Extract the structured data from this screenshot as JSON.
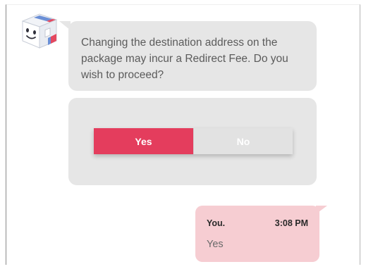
{
  "bot": {
    "avatar_icon": "package-box-mascot-icon",
    "message": "Changing the destination address on the package may incur a Redirect Fee. Do you wish to proceed?"
  },
  "choices": {
    "yes_label": "Yes",
    "no_label": "No"
  },
  "user_message": {
    "sender": "You.",
    "time": "3:08 PM",
    "text": "Yes"
  },
  "colors": {
    "accent": "#e43d5d",
    "bot_bubble": "#e6e6e6",
    "user_bubble": "#f6cdd2"
  }
}
